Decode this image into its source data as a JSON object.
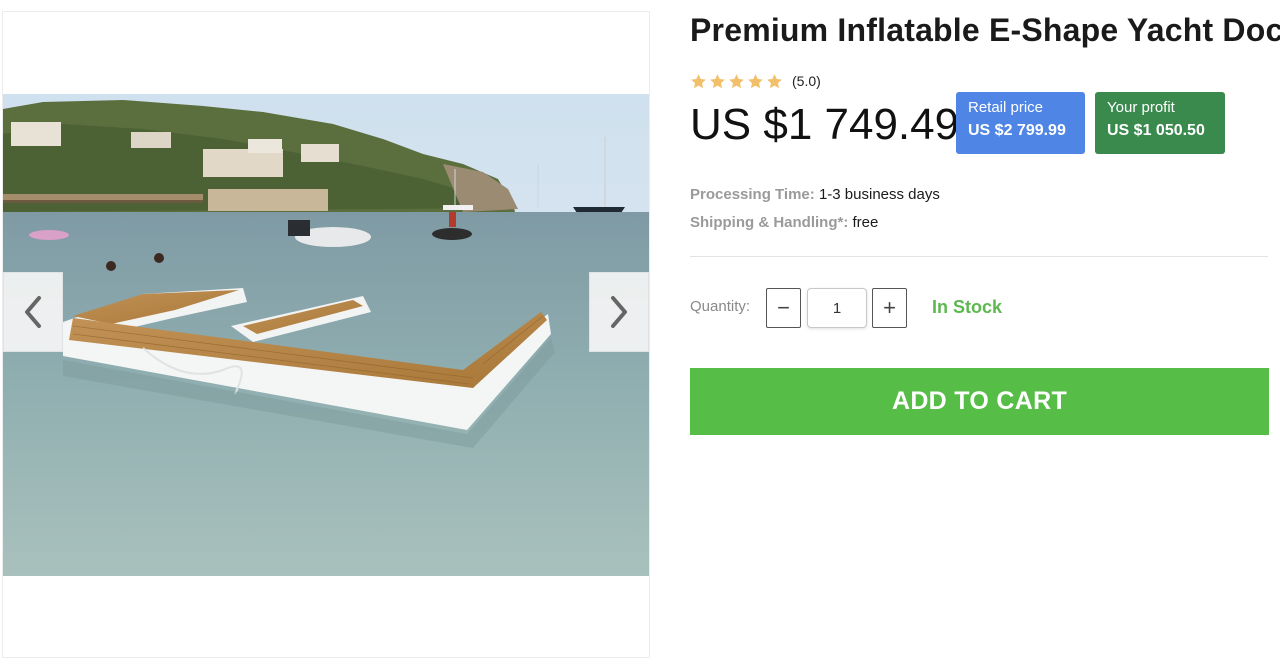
{
  "gallery": {
    "prev_icon": "chevron-left-icon",
    "next_icon": "chevron-right-icon"
  },
  "product": {
    "title": "Premium Inflatable E-Shape Yacht Dock",
    "rating_text": "(5.0)",
    "rating_value": 5,
    "rating_max": 5,
    "price": "US $1 749.49"
  },
  "retail": {
    "label": "Retail price",
    "value": "US $2 799.99"
  },
  "profit": {
    "label": "Your profit",
    "value": "US $1 050.50"
  },
  "processing": {
    "label": "Processing Time:",
    "value": "1-3 business days"
  },
  "shipping": {
    "label": "Shipping & Handling*:",
    "value": "free"
  },
  "quantity": {
    "label": "Quantity:",
    "value": "1",
    "minus": "−",
    "plus": "+"
  },
  "stock": "In Stock",
  "cart_button": "ADD TO CART",
  "colors": {
    "star": "#f2bf6a",
    "retail_badge": "#4f85e4",
    "profit_badge": "#3a8a4e",
    "in_stock": "#5cb84f",
    "cart_button": "#56bd47"
  }
}
